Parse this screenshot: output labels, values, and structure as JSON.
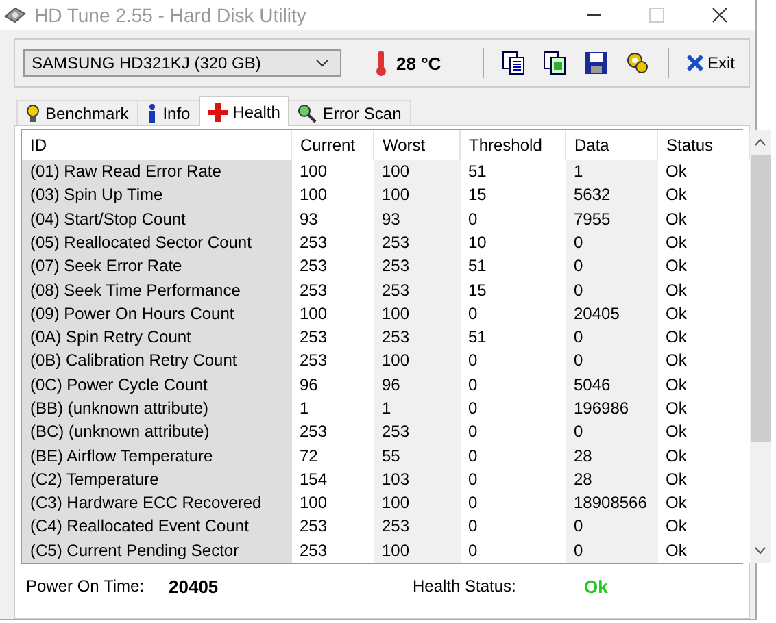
{
  "window": {
    "title": "HD Tune 2.55 - Hard Disk Utility"
  },
  "toolbar": {
    "drive": "SAMSUNG HD321KJ (320 GB)",
    "temperature": "28 °C",
    "exit_label": "Exit"
  },
  "tabs": [
    {
      "label": "Benchmark",
      "selected": false
    },
    {
      "label": "Info",
      "selected": false
    },
    {
      "label": "Health",
      "selected": true
    },
    {
      "label": "Error Scan",
      "selected": false
    }
  ],
  "table": {
    "columns": [
      "ID",
      "Current",
      "Worst",
      "Threshold",
      "Data",
      "Status"
    ],
    "rows": [
      [
        "(01) Raw Read Error Rate",
        "100",
        "100",
        "51",
        "1",
        "Ok"
      ],
      [
        "(03) Spin Up Time",
        "100",
        "100",
        "15",
        "5632",
        "Ok"
      ],
      [
        "(04) Start/Stop Count",
        "93",
        "93",
        "0",
        "7955",
        "Ok"
      ],
      [
        "(05) Reallocated Sector Count",
        "253",
        "253",
        "10",
        "0",
        "Ok"
      ],
      [
        "(07) Seek Error Rate",
        "253",
        "253",
        "51",
        "0",
        "Ok"
      ],
      [
        "(08) Seek Time Performance",
        "253",
        "253",
        "15",
        "0",
        "Ok"
      ],
      [
        "(09) Power On Hours Count",
        "100",
        "100",
        "0",
        "20405",
        "Ok"
      ],
      [
        "(0A) Spin Retry Count",
        "253",
        "253",
        "51",
        "0",
        "Ok"
      ],
      [
        "(0B) Calibration Retry Count",
        "253",
        "100",
        "0",
        "0",
        "Ok"
      ],
      [
        "(0C) Power Cycle Count",
        "96",
        "96",
        "0",
        "5046",
        "Ok"
      ],
      [
        "(BB) (unknown attribute)",
        "1",
        "1",
        "0",
        "196986",
        "Ok"
      ],
      [
        "(BC) (unknown attribute)",
        "253",
        "253",
        "0",
        "0",
        "Ok"
      ],
      [
        "(BE) Airflow Temperature",
        "72",
        "55",
        "0",
        "28",
        "Ok"
      ],
      [
        "(C2) Temperature",
        "154",
        "103",
        "0",
        "28",
        "Ok"
      ],
      [
        "(C3) Hardware ECC Recovered",
        "100",
        "100",
        "0",
        "18908566",
        "Ok"
      ],
      [
        "(C4) Reallocated Event Count",
        "253",
        "253",
        "0",
        "0",
        "Ok"
      ],
      [
        "(C5) Current Pending Sector",
        "253",
        "100",
        "0",
        "0",
        "Ok"
      ]
    ]
  },
  "status_bar": {
    "power_on_label": "Power On Time:",
    "power_on_value": "20405",
    "health_label": "Health Status:",
    "health_value": "Ok"
  }
}
